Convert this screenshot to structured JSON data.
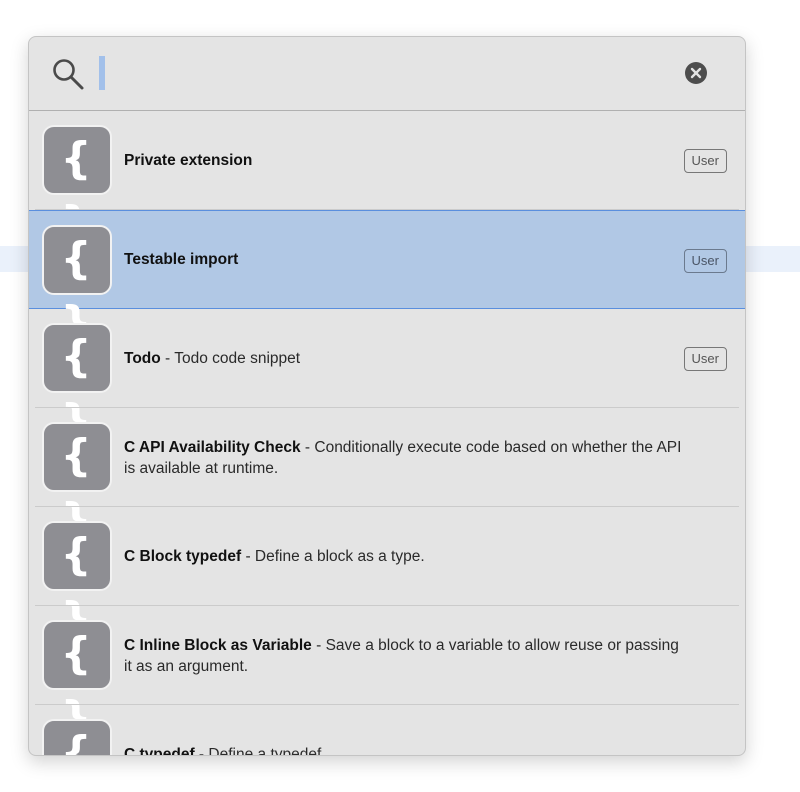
{
  "search": {
    "value": "",
    "clear_icon": "close-circle-icon",
    "search_icon": "magnifier-icon"
  },
  "colors": {
    "selected_row": "#b1c8e5",
    "selected_border": "#5a8fde",
    "caret": "#a2c0ea",
    "icon_bg": "#8e8e93"
  },
  "snippets": [
    {
      "title": "Private extension",
      "separator": "",
      "description": "",
      "badge": "User",
      "icon": "braces-icon",
      "selected": false
    },
    {
      "title": "Testable import",
      "separator": "",
      "description": "",
      "badge": "User",
      "icon": "braces-icon",
      "selected": true
    },
    {
      "title": "Todo",
      "separator": " - ",
      "description": "Todo code snippet",
      "badge": "User",
      "icon": "braces-icon",
      "selected": false
    },
    {
      "title": "C API Availability Check",
      "separator": " - ",
      "description": "Conditionally execute code based on whether the API is available at runtime.",
      "badge": "",
      "icon": "braces-icon",
      "selected": false
    },
    {
      "title": "C Block typedef",
      "separator": " - ",
      "description": "Define a block as a type.",
      "badge": "",
      "icon": "braces-icon",
      "selected": false
    },
    {
      "title": "C Inline Block as Variable",
      "separator": " - ",
      "description": "Save a block to a variable to allow reuse or passing it as an argument.",
      "badge": "",
      "icon": "braces-icon",
      "selected": false
    },
    {
      "title": "C typedef",
      "separator": " - ",
      "description": "Define a typedef.",
      "badge": "",
      "icon": "braces-icon",
      "selected": false
    }
  ],
  "braces_glyph": "{ }"
}
